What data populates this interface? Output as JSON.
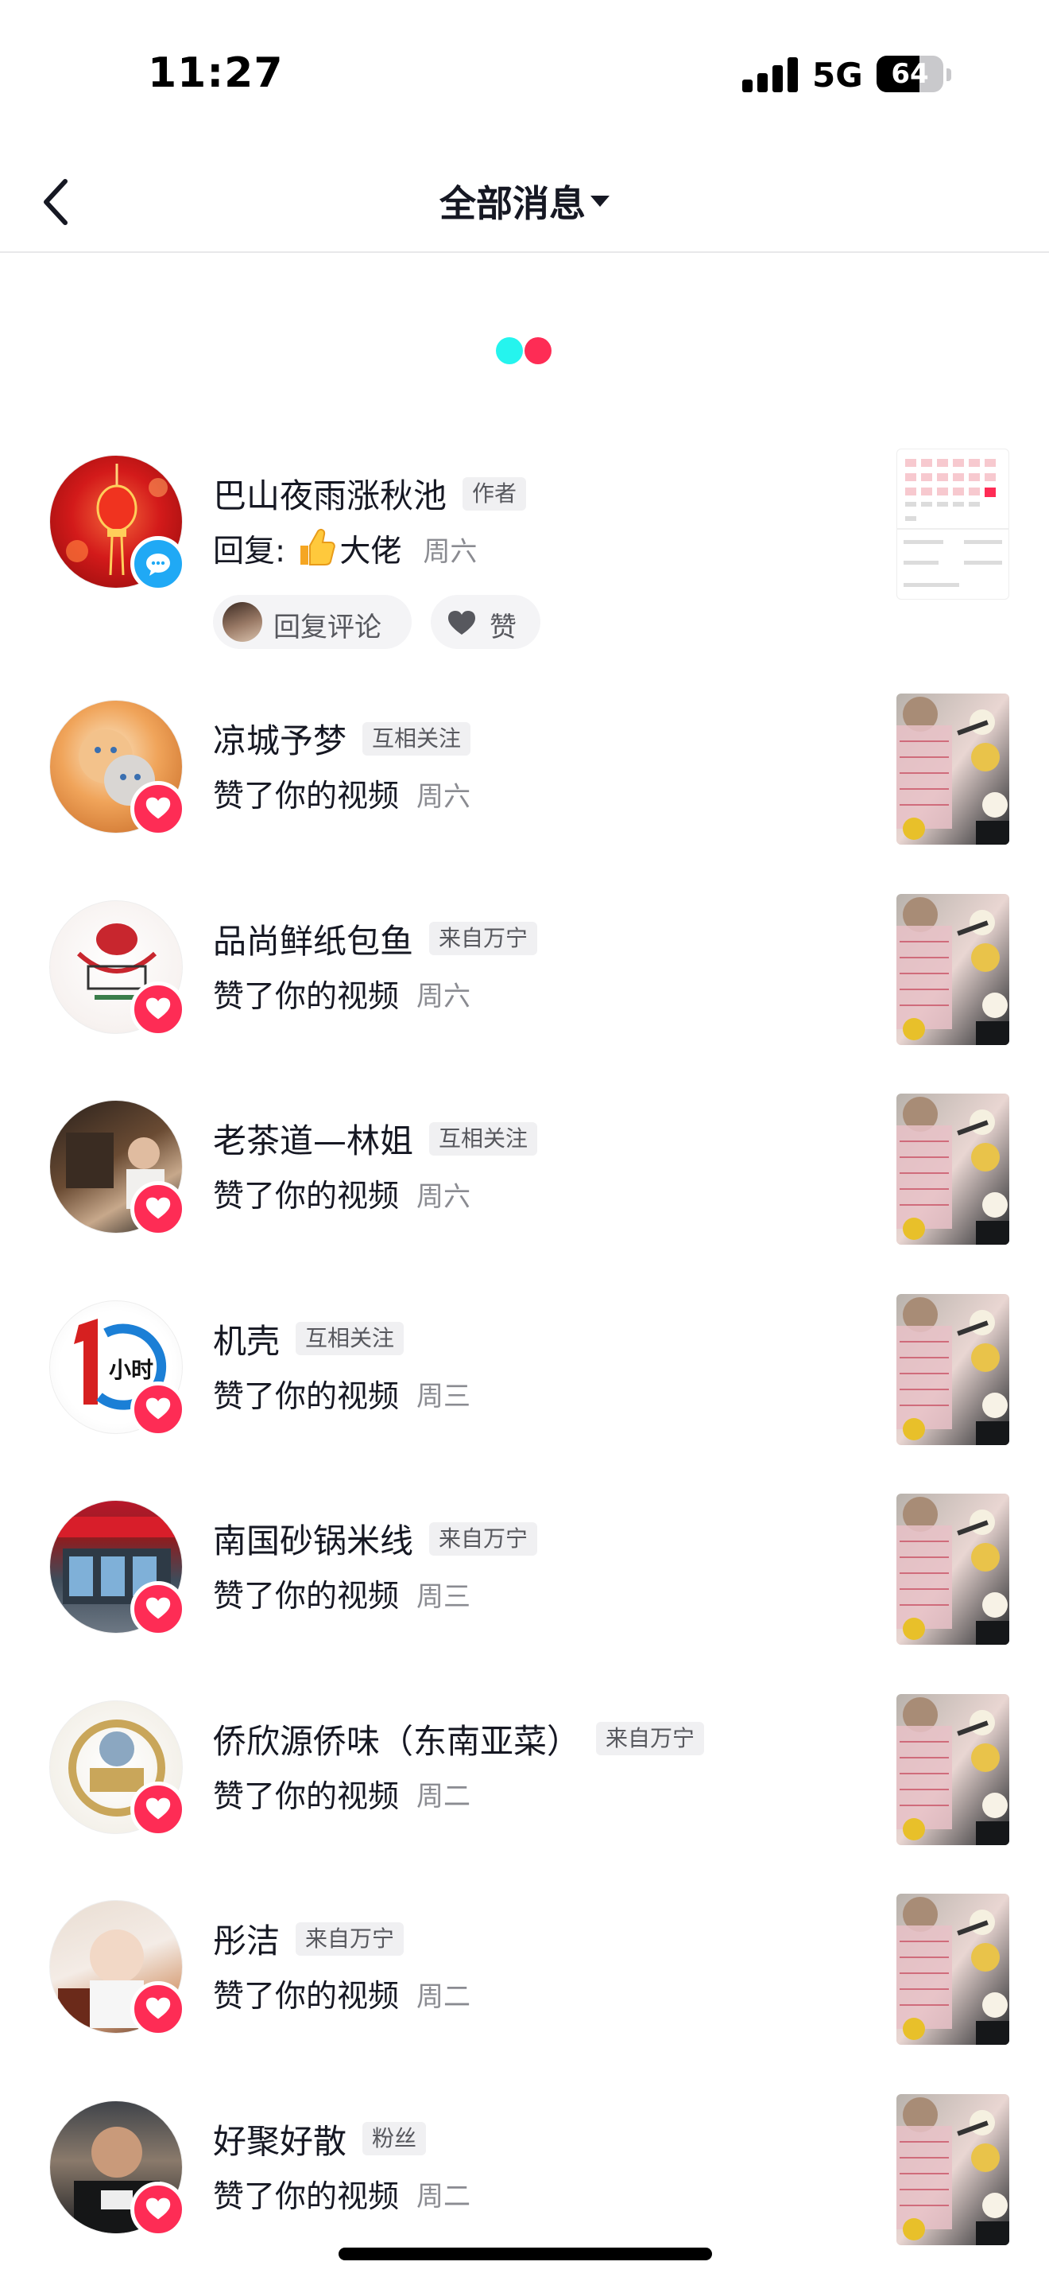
{
  "status_bar": {
    "time": "11:27",
    "network": "5G",
    "battery": "64",
    "battery_level": 0.64
  },
  "nav": {
    "title": "全部消息"
  },
  "first_item": {
    "name": "巴山夜雨涨秋池",
    "tag": "作者",
    "reply_prefix": "回复:",
    "reply_text": "大佬",
    "time": "周六",
    "reply_button": "回复评论",
    "like_button": "赞"
  },
  "items": [
    {
      "name": "凉城予梦",
      "tag": "互相关注",
      "action": "赞了你的视频",
      "time": "周六"
    },
    {
      "name": "品尚鲜纸包鱼",
      "tag": "来自万宁",
      "action": "赞了你的视频",
      "time": "周六"
    },
    {
      "name": "老茶道—林姐",
      "tag": "互相关注",
      "action": "赞了你的视频",
      "time": "周六"
    },
    {
      "name": "机壳",
      "tag": "互相关注",
      "action": "赞了你的视频",
      "time": "周三"
    },
    {
      "name": "南国砂锅米线",
      "tag": "来自万宁",
      "action": "赞了你的视频",
      "time": "周三"
    },
    {
      "name": "侨欣源侨味（东南亚菜）",
      "tag": "来自万宁",
      "action": "赞了你的视频",
      "time": "周二"
    },
    {
      "name": "彤洁",
      "tag": "来自万宁",
      "action": "赞了你的视频",
      "time": "周二"
    },
    {
      "name": "好聚好散",
      "tag": "粉丝",
      "action": "赞了你的视频",
      "time": "周二"
    }
  ],
  "colors": {
    "like_red": "#fe2c55",
    "comment_blue": "#20a9f5",
    "loader_cyan": "#25f4ee",
    "loader_red": "#fe2c55"
  }
}
